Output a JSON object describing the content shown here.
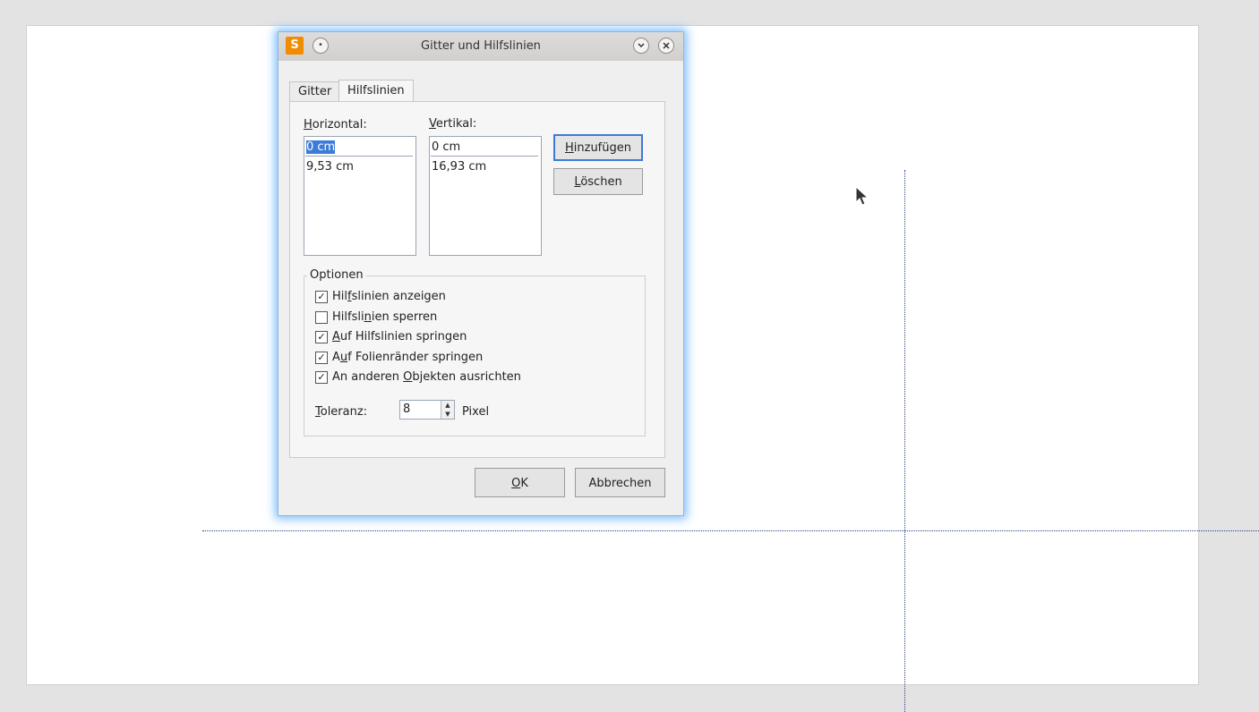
{
  "dialog": {
    "title": "Gitter und Hilfslinien",
    "app_icon_letter": "S",
    "tabs": [
      {
        "label": "Gitter",
        "active": false
      },
      {
        "label": "Hilfslinien",
        "active": true
      }
    ],
    "horizontal": {
      "label_mnemonic": "H",
      "label_rest": "orizontal:",
      "value": "0 cm",
      "items": [
        "9,53 cm"
      ]
    },
    "vertical": {
      "label_mnemonic": "V",
      "label_rest": "ertikal:",
      "value": "0 cm",
      "items": [
        "16,93 cm"
      ]
    },
    "buttons": {
      "add_m": "H",
      "add_rest": "inzufügen",
      "delete_m": "L",
      "delete_rest": "öschen",
      "ok_m": "O",
      "ok_rest": "K",
      "cancel": "Abbrechen"
    },
    "options": {
      "legend": "Optionen",
      "checkboxes": [
        {
          "pre": "Hil",
          "m": "f",
          "post": "slinien anzeigen",
          "checked": true
        },
        {
          "pre": "Hilfsli",
          "m": "n",
          "post": "ien sperren",
          "checked": false
        },
        {
          "pre": "",
          "m": "A",
          "post": "uf Hilfslinien springen",
          "checked": true
        },
        {
          "pre": "A",
          "m": "u",
          "post": "f Folienränder springen",
          "checked": true
        },
        {
          "pre": "An anderen ",
          "m": "O",
          "post": "bjekten ausrichten",
          "checked": true
        }
      ],
      "tolerance_m": "T",
      "tolerance_rest": "oleranz:",
      "tolerance_value": "8",
      "tolerance_unit": "Pixel"
    }
  },
  "colors": {
    "accent": "#3d7bd9",
    "guide_line": "#2c3e8f",
    "app_icon": "#f08c00"
  }
}
